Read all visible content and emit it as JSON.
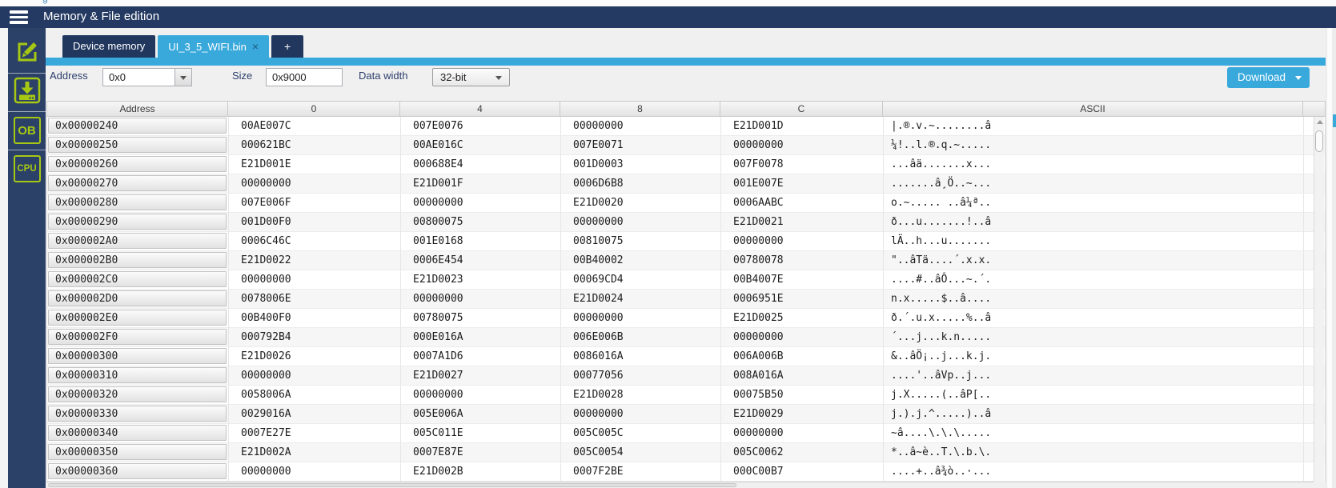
{
  "header": {
    "title": "Memory & File edition",
    "top_fragment": "g"
  },
  "colors": {
    "accent_cyan": "#39a9dc",
    "navy": "#253a62",
    "sidebar_navy": "#2c4168",
    "icon_green": "#a6c813"
  },
  "icons": {
    "hamburger": "hamburger-menu",
    "edit": "pencil-square",
    "download": "download-tray",
    "dropdown": "caret-down",
    "close": "×",
    "scroll_up": "chevron-up"
  },
  "sidebar": {
    "items": [
      {
        "name": "memory-file-edition",
        "icon": "pencil-icon",
        "label": ""
      },
      {
        "name": "download",
        "icon": "download-icon",
        "label": ""
      },
      {
        "name": "option-bytes",
        "icon": "ob-icon",
        "label": "OB"
      },
      {
        "name": "cpu",
        "icon": "cpu-icon",
        "label": "CPU"
      }
    ]
  },
  "tabs": [
    {
      "label": "Device memory",
      "active": false
    },
    {
      "label": "UI_3_5_WIFI.bin",
      "active": true,
      "closable": true
    },
    {
      "label": "+",
      "active": false
    }
  ],
  "controls": {
    "address_label": "Address",
    "address_value": "0x0",
    "size_label": "Size",
    "size_value": "0x9000",
    "data_width_label": "Data width",
    "data_width_value": "32-bit",
    "download_label": "Download"
  },
  "table": {
    "columns": [
      "Address",
      "0",
      "4",
      "8",
      "C",
      "ASCII"
    ],
    "rows": [
      {
        "address": "0x00000240",
        "values": [
          "00AE007C",
          "007E0076",
          "00000000",
          "E21D001D"
        ],
        "ascii": "|.®.v.~........â"
      },
      {
        "address": "0x00000250",
        "values": [
          "000621BC",
          "00AE016C",
          "007E0071",
          "00000000"
        ],
        "ascii": "¼!..l.®.q.~....."
      },
      {
        "address": "0x00000260",
        "values": [
          "E21D001E",
          "000688E4",
          "001D0003",
          "007F0078"
        ],
        "ascii": "...âä.......x..."
      },
      {
        "address": "0x00000270",
        "values": [
          "00000000",
          "E21D001F",
          "0006D6B8",
          "001E007E"
        ],
        "ascii": ".......â¸Ö..~..."
      },
      {
        "address": "0x00000280",
        "values": [
          "007E006F",
          "00000000",
          "E21D0020",
          "0006AABC"
        ],
        "ascii": "o.~..... ..â¼ª.."
      },
      {
        "address": "0x00000290",
        "values": [
          "001D00F0",
          "00800075",
          "00000000",
          "E21D0021"
        ],
        "ascii": "ð...u.......!..â"
      },
      {
        "address": "0x000002A0",
        "values": [
          "0006C46C",
          "001E0168",
          "00810075",
          "00000000"
        ],
        "ascii": "lÄ..h...u......."
      },
      {
        "address": "0x000002B0",
        "values": [
          "E21D0022",
          "0006E454",
          "00B40002",
          "00780078"
        ],
        "ascii": "\"..âTä....´.x.x."
      },
      {
        "address": "0x000002C0",
        "values": [
          "00000000",
          "E21D0023",
          "00069CD4",
          "00B4007E"
        ],
        "ascii": "....#..âÔ...~.´."
      },
      {
        "address": "0x000002D0",
        "values": [
          "0078006E",
          "00000000",
          "E21D0024",
          "0006951E"
        ],
        "ascii": "n.x.....$..â...."
      },
      {
        "address": "0x000002E0",
        "values": [
          "00B400F0",
          "00780075",
          "00000000",
          "E21D0025"
        ],
        "ascii": "ð.´.u.x.....%..â"
      },
      {
        "address": "0x000002F0",
        "values": [
          "000792B4",
          "000E016A",
          "006E006B",
          "00000000"
        ],
        "ascii": "´...j...k.n....."
      },
      {
        "address": "0x00000300",
        "values": [
          "E21D0026",
          "0007A1D6",
          "0086016A",
          "006A006B"
        ],
        "ascii": "&..âÖ¡..j...k.j."
      },
      {
        "address": "0x00000310",
        "values": [
          "00000000",
          "E21D0027",
          "00077056",
          "008A016A"
        ],
        "ascii": "....'..âVp..j..."
      },
      {
        "address": "0x00000320",
        "values": [
          "0058006A",
          "00000000",
          "E21D0028",
          "00075B50"
        ],
        "ascii": "j.X.....(..âP[.."
      },
      {
        "address": "0x00000330",
        "values": [
          "0029016A",
          "005E006A",
          "00000000",
          "E21D0029"
        ],
        "ascii": "j.).j.^.....)..â"
      },
      {
        "address": "0x00000340",
        "values": [
          "0007E27E",
          "005C011E",
          "005C005C",
          "00000000"
        ],
        "ascii": "~â....\\.\\.\\....."
      },
      {
        "address": "0x00000350",
        "values": [
          "E21D002A",
          "0007E87E",
          "005C0054",
          "005C0062"
        ],
        "ascii": "*..â~è..T.\\.b.\\."
      },
      {
        "address": "0x00000360",
        "values": [
          "00000000",
          "E21D002B",
          "0007F2BE",
          "000C00B7"
        ],
        "ascii": "....+..â¾ò..·..."
      }
    ]
  }
}
